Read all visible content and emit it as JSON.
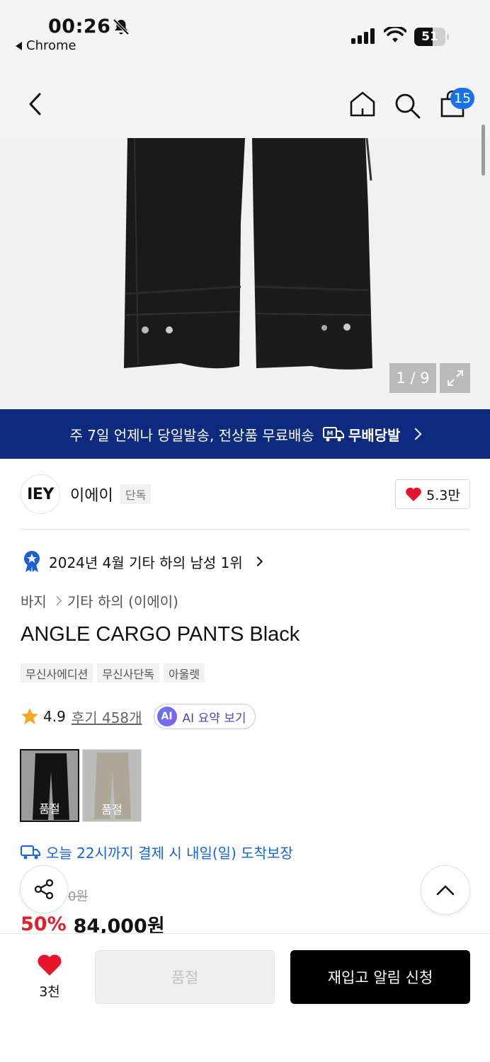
{
  "status_bar": {
    "time": "00:26",
    "back_app": "Chrome",
    "battery": "51"
  },
  "nav": {
    "cart_count": "15",
    "icons": [
      "chevron-left-icon",
      "home-icon",
      "search-icon",
      "shopping-bag-icon"
    ]
  },
  "gallery": {
    "pager": "1 / 9"
  },
  "banner": {
    "text": "주 7일 언제나 당일발송, 전상품 무료배송",
    "brand": "무배당발"
  },
  "brand": {
    "logo_text": "IEY",
    "name": "이에이",
    "tag": "단독",
    "likes": "5.3만"
  },
  "ranking": {
    "text": "2024년 4월 기타 하의 남성 1위"
  },
  "breadcrumb": {
    "level1": "바지",
    "level2": "기타 하의 (이에이)"
  },
  "product": {
    "title": "ANGLE CARGO PANTS Black",
    "tags": [
      "무신사에디션",
      "무신사단독",
      "아울렛"
    ],
    "rating": "4.9",
    "reviews": "후기 458개",
    "ai_badge": "AI",
    "ai_summary": "AI 요약 보기"
  },
  "swatches": [
    {
      "label": "품절"
    },
    {
      "label": "품절"
    }
  ],
  "delivery": {
    "text": "오늘 22시까지 결제 시 내일(일) 도착보장"
  },
  "price": {
    "original": "0원",
    "discount": "50%",
    "final": "84,000원"
  },
  "bottom": {
    "like_count": "3천",
    "soldout_label": "품절",
    "restock_label": "재입고 알림 신청"
  },
  "colors": {
    "banner_bg": "#0d2a80",
    "accent_blue": "#1873eb",
    "discount_red": "#e0202a",
    "heart_red": "#e8142b"
  }
}
